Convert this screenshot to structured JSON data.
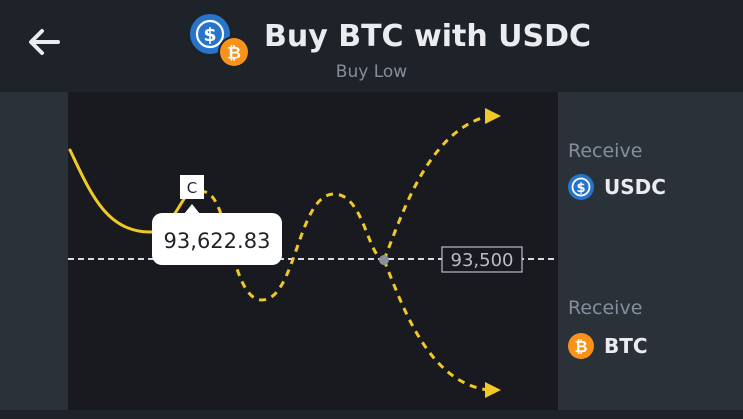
{
  "header": {
    "title": "Buy BTC with USDC",
    "subtitle": "Buy Low"
  },
  "chart": {
    "marker_letter": "C",
    "current_price": "93,622.83",
    "target_price": "93,500"
  },
  "receive": [
    {
      "label": "Receive",
      "asset": "USDC",
      "icon": "usdc-icon"
    },
    {
      "label": "Receive",
      "asset": "BTC",
      "icon": "btc-icon"
    }
  ],
  "colors": {
    "background": "#1e2329",
    "chart_background": "#181a20",
    "side_panel": "#2b3139",
    "accent_yellow": "#f0c929",
    "usdc_blue": "#2775ca",
    "btc_orange": "#f7931a"
  }
}
